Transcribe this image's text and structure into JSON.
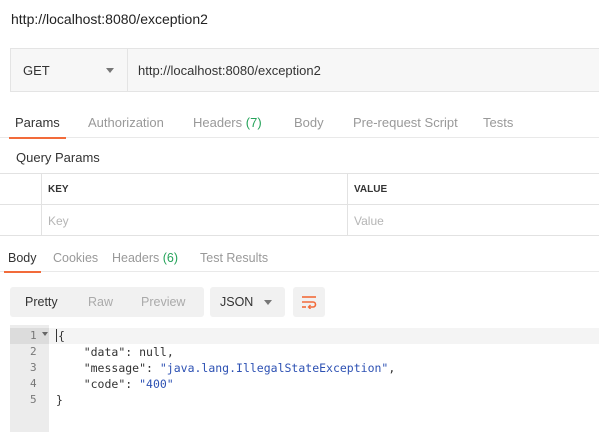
{
  "window": {
    "title": "http://localhost:8080/exception2"
  },
  "request": {
    "method": "GET",
    "url": "http://localhost:8080/exception2"
  },
  "request_tabs": [
    {
      "label": "Params",
      "active": true
    },
    {
      "label": "Authorization"
    },
    {
      "label": "Headers",
      "count": "(7)"
    },
    {
      "label": "Body"
    },
    {
      "label": "Pre-request Script"
    },
    {
      "label": "Tests"
    }
  ],
  "query_params": {
    "title": "Query Params",
    "columns": [
      "KEY",
      "VALUE"
    ],
    "placeholders": {
      "key": "Key",
      "value": "Value"
    }
  },
  "response_tabs": [
    {
      "label": "Body",
      "active": true
    },
    {
      "label": "Cookies"
    },
    {
      "label": "Headers",
      "count": "(6)"
    },
    {
      "label": "Test Results"
    }
  ],
  "format_bar": {
    "modes": [
      "Pretty",
      "Raw",
      "Preview"
    ],
    "active_mode": "Pretty",
    "language": "JSON",
    "wrap_icon": "wrap-lines-icon"
  },
  "response_body": {
    "line_numbers": [
      "1",
      "2",
      "3",
      "4",
      "5"
    ],
    "open_brace": "{",
    "close_brace": "}",
    "fields": [
      {
        "key": "\"data\"",
        "value": "null",
        "type": "literal",
        "trail": ","
      },
      {
        "key": "\"message\"",
        "value": "\"java.lang.IllegalStateException\"",
        "type": "string",
        "trail": ","
      },
      {
        "key": "\"code\"",
        "value": "\"400\"",
        "type": "string",
        "trail": ""
      }
    ]
  },
  "colors": {
    "accent": "#f26b3a",
    "count": "#25a35a",
    "string": "#2d51b3"
  }
}
